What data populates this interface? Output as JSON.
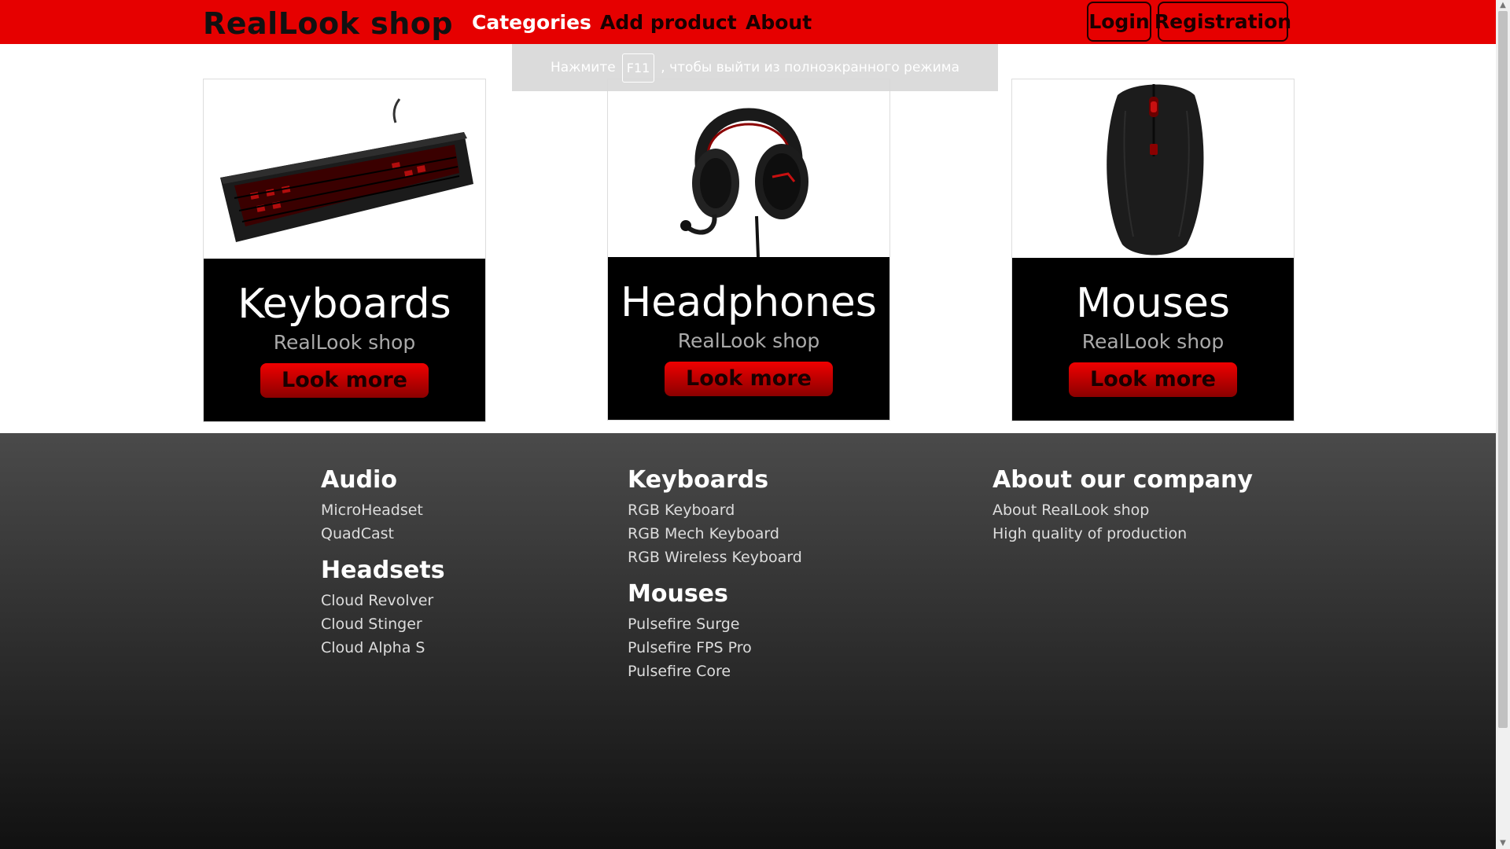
{
  "header": {
    "logo": "RealLook shop",
    "nav": {
      "categories": "Categories",
      "add_product": "Add product",
      "about": "About"
    },
    "login": "Login",
    "registration": "Registration"
  },
  "notice": {
    "before": "Нажмите",
    "key": "F11",
    "after": ", чтобы выйти из полноэкранного режима"
  },
  "cards": [
    {
      "title": "Keyboards",
      "subtitle": "RealLook shop",
      "button": "Look more"
    },
    {
      "title": "Headphones",
      "subtitle": "RealLook shop",
      "button": "Look more"
    },
    {
      "title": "Mouses",
      "subtitle": "RealLook shop",
      "button": "Look more"
    }
  ],
  "footer": {
    "audio": {
      "heading": "Audio",
      "links": [
        "MicroHeadset",
        "QuadCast"
      ]
    },
    "headsets": {
      "heading": "Headsets",
      "links": [
        "Cloud Revolver",
        "Cloud Stinger",
        "Cloud Alpha S"
      ]
    },
    "keyboards": {
      "heading": "Keyboards",
      "links": [
        "RGB Keyboard",
        "RGB Mech Keyboard",
        "RGB Wireless Keyboard"
      ]
    },
    "mouses": {
      "heading": "Mouses",
      "links": [
        "Pulsefire Surge",
        "Pulsefire FPS Pro",
        "Pulsefire Core"
      ]
    },
    "company": {
      "heading": "About our company",
      "links": [
        "About RealLook shop",
        "High quality of production"
      ]
    }
  },
  "colors": {
    "brand_red": "#e60000",
    "card_dark": "#000000",
    "footer_top": "#4a4a4a",
    "footer_bottom": "#111111"
  }
}
